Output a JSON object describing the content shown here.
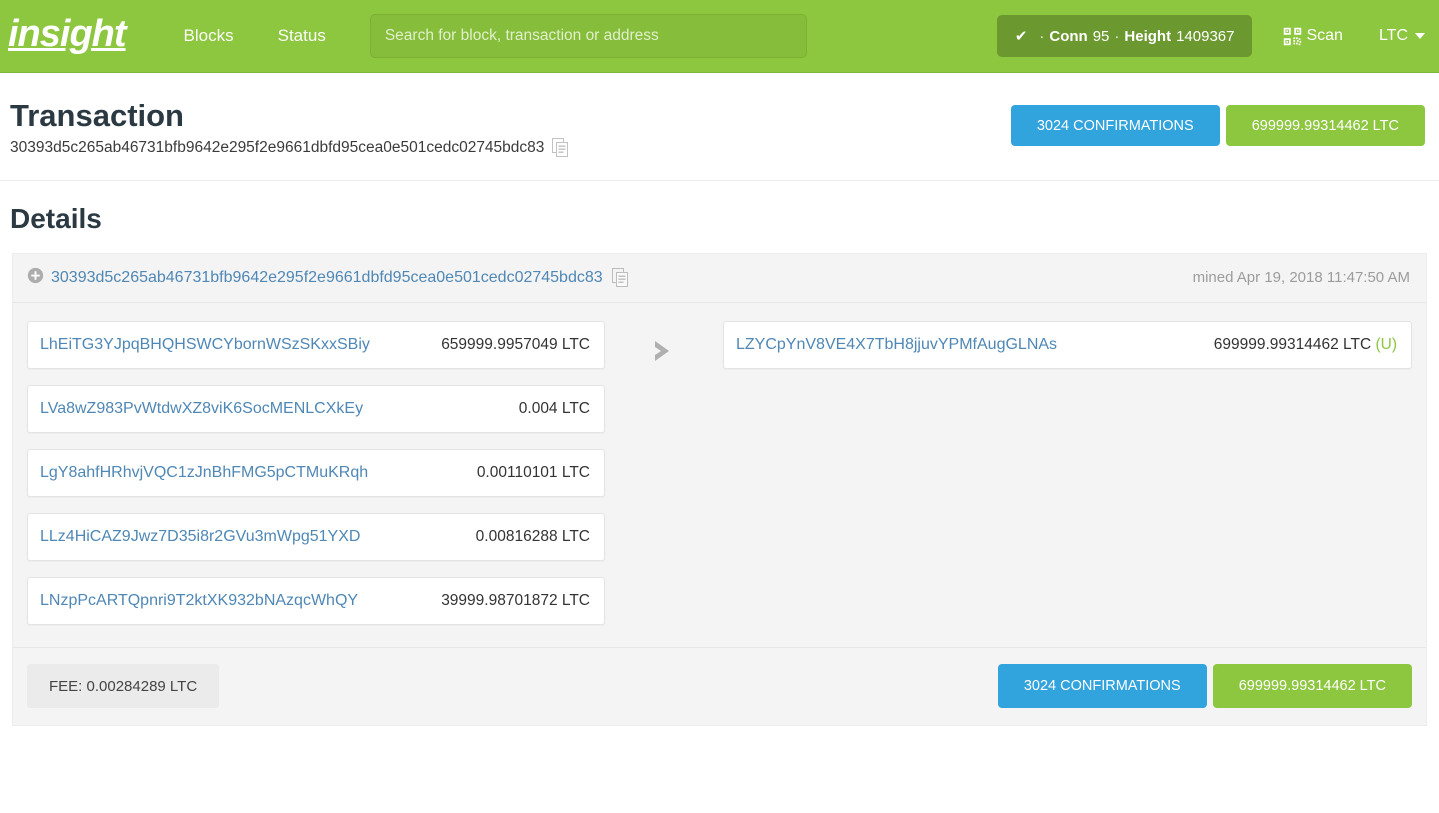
{
  "navbar": {
    "brand": "insight",
    "links": [
      {
        "label": "Blocks",
        "name": "nav-link-blocks"
      },
      {
        "label": "Status",
        "name": "nav-link-status"
      }
    ],
    "search": {
      "placeholder": "Search for block, transaction or address",
      "value": ""
    },
    "status": {
      "check": "✔",
      "sep": "·",
      "conn_label": "Conn",
      "conn_value": "95",
      "height_label": "Height",
      "height_value": "1409367"
    },
    "scan_label": "Scan",
    "currency": "LTC"
  },
  "header": {
    "title": "Transaction",
    "txid": "30393d5c265ab46731bfb9642e295f2e9661dbfd95cea0e501cedc02745bdc83",
    "confirmations_badge": "3024 CONFIRMATIONS",
    "amount_badge": "699999.99314462 LTC"
  },
  "details": {
    "title": "Details",
    "panel": {
      "txid": "30393d5c265ab46731bfb9642e295f2e9661dbfd95cea0e501cedc02745bdc83",
      "mined": "mined Apr 19, 2018 11:47:50 AM"
    },
    "inputs": [
      {
        "address": "LhEiTG3YJpqBHQHSWCYbornWSzSKxxSBiy",
        "amount": "659999.9957049 LTC"
      },
      {
        "address": "LVa8wZ983PvWtdwXZ8viK6SocMENLCXkEy",
        "amount": "0.004 LTC"
      },
      {
        "address": "LgY8ahfHRhvjVQC1zJnBhFMG5pCTMuKRqh",
        "amount": "0.00110101 LTC"
      },
      {
        "address": "LLz4HiCAZ9Jwz7D35i8r2GVu3mWpg51YXD",
        "amount": "0.00816288 LTC"
      },
      {
        "address": "LNzpPcARTQpnri9T2ktXK932bNAzqcWhQY",
        "amount": "39999.98701872 LTC"
      }
    ],
    "outputs": [
      {
        "address": "LZYCpYnV8VE4X7TbH8jjuvYPMfAugGLNAs",
        "amount": "699999.99314462 LTC",
        "unspent": "(U)"
      }
    ],
    "footer": {
      "fee": "FEE: 0.00284289 LTC",
      "confirmations_badge": "3024 CONFIRMATIONS",
      "amount_badge": "699999.99314462 LTC"
    }
  },
  "colors": {
    "brand_green": "#8dc63f",
    "nav_pill": "#6c9830",
    "badge_blue": "#31a3dd",
    "link_blue": "#4f87b5",
    "heading": "#2b3a42"
  }
}
